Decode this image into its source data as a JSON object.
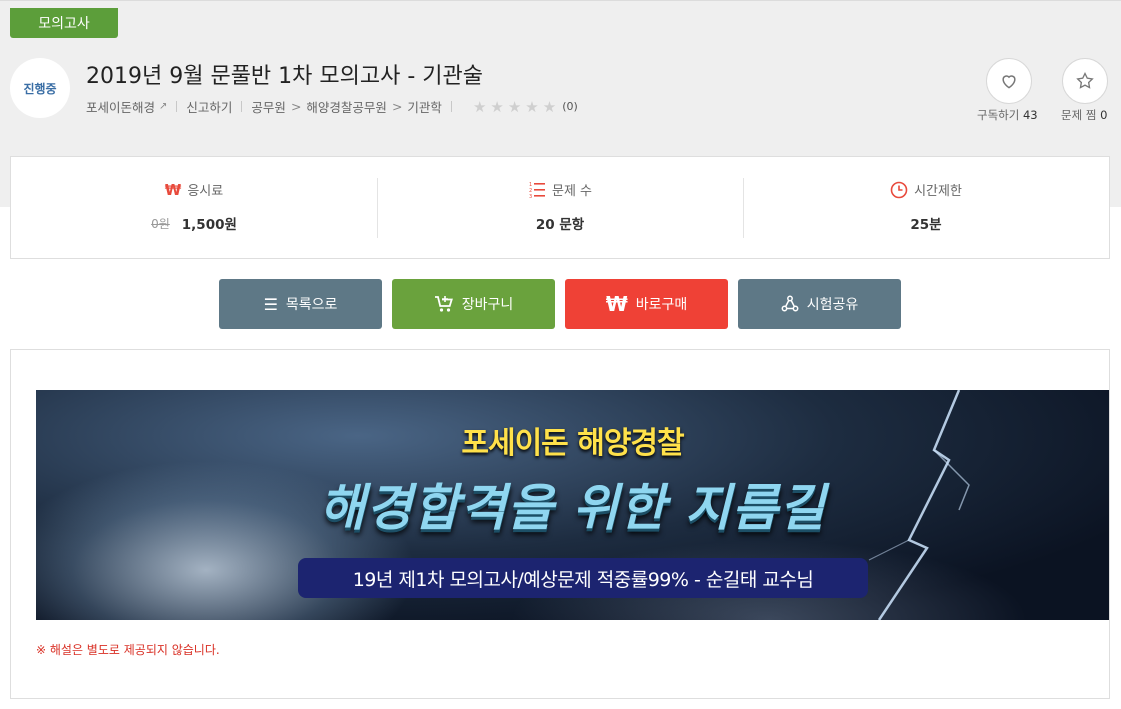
{
  "header": {
    "category_tag": "모의고사",
    "status": "진행중",
    "title": "2019년 9월 문풀반 1차 모의고사 - 기관술",
    "provider": "포세이돈해경",
    "report": "신고하기",
    "breadcrumb": [
      "공무원",
      "해양경찰공무원",
      "기관학"
    ],
    "rating_stars": 0,
    "rating_count": "(0)"
  },
  "actions": {
    "subscribe_label": "구독하기",
    "subscribe_count": "43",
    "wishlist_label": "문제 찜",
    "wishlist_count": "0"
  },
  "info": {
    "fee_label": "응시료",
    "fee_original": "0원",
    "fee_price": "1,500원",
    "count_label": "문제 수",
    "count_value": "20 문항",
    "time_label": "시간제한",
    "time_value": "25분"
  },
  "buttons": {
    "list": "목록으로",
    "cart": "장바구니",
    "buy": "바로구매",
    "share": "시험공유"
  },
  "banner": {
    "subtitle": "포세이돈 해양경찰",
    "headline": "해경합격을 위한 지름길",
    "caption": "19년 제1차 모의고사/예상문제 적중률99% - 순길태 교수님"
  },
  "notice": "※ 해설은 별도로 제공되지 않습니다.",
  "colors": {
    "tag_green": "#5c9e3a",
    "btn_gray": "#5e7886",
    "btn_green": "#6aa23d",
    "btn_red": "#ef4136",
    "accent_red": "#e84a3c"
  }
}
